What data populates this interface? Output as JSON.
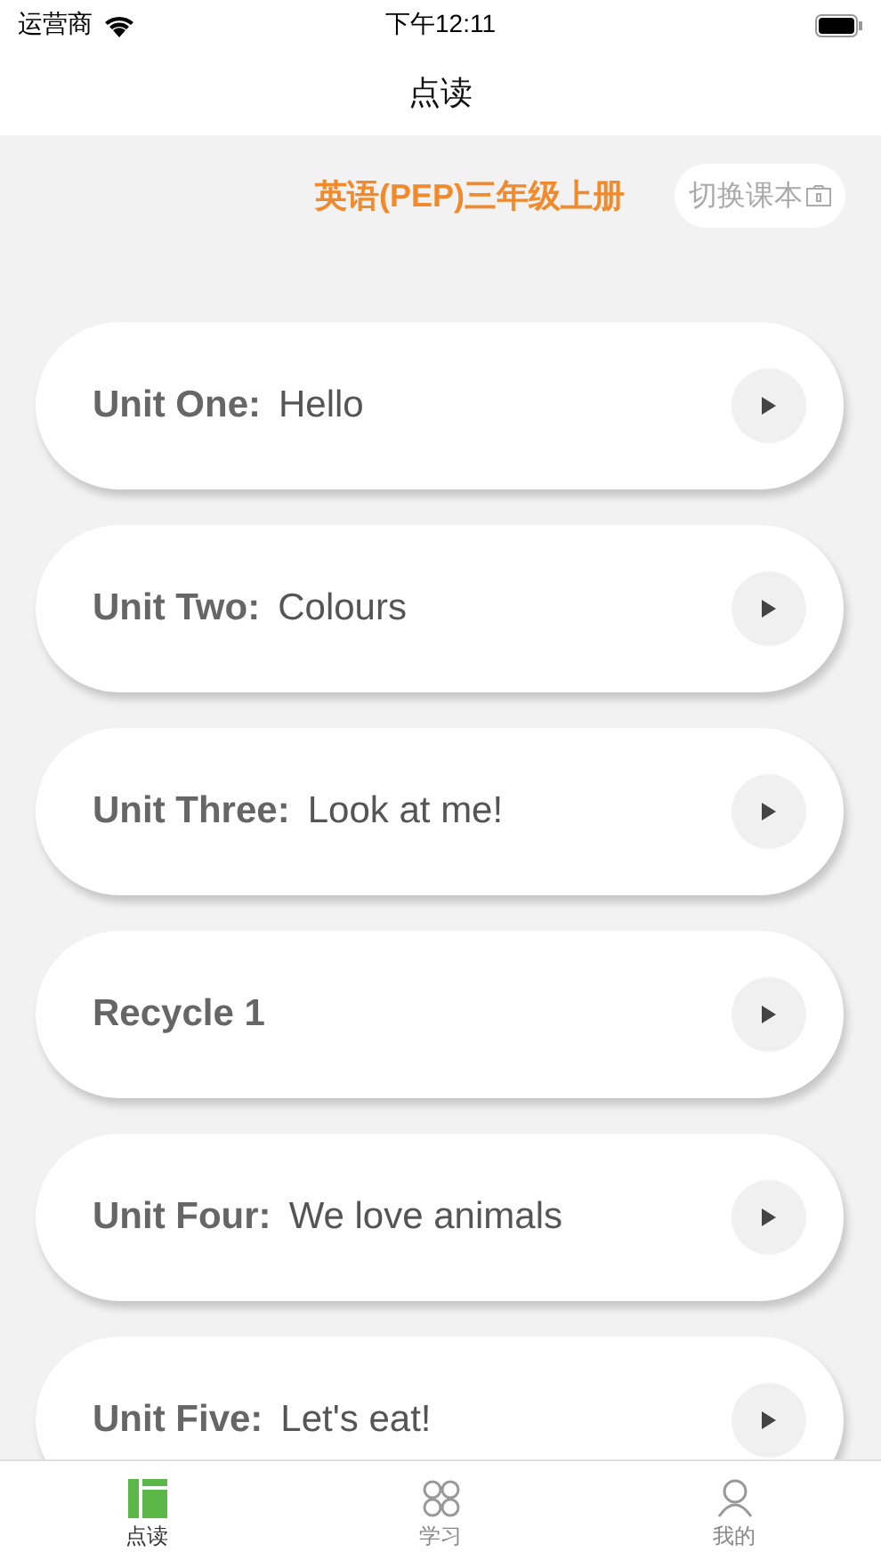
{
  "status_bar": {
    "carrier": "运营商",
    "time": "下午12:11"
  },
  "nav": {
    "title": "点读"
  },
  "book": {
    "title": "英语(PEP)三年级上册",
    "switch_button": "切换课本"
  },
  "units": [
    {
      "label": "Unit One:",
      "title": "Hello"
    },
    {
      "label": "Unit Two:",
      "title": "Colours"
    },
    {
      "label": "Unit Three:",
      "title": "Look at me!"
    },
    {
      "label": "Recycle 1"
    },
    {
      "label": "Unit Four:",
      "title": "We love animals"
    },
    {
      "label": "Unit Five:",
      "title": "Let's eat!"
    }
  ],
  "tabs": [
    {
      "label": "点读",
      "selected": true,
      "kind": "read"
    },
    {
      "label": "学习",
      "selected": false,
      "kind": "learn"
    },
    {
      "label": "我的",
      "selected": false,
      "kind": "me"
    }
  ]
}
